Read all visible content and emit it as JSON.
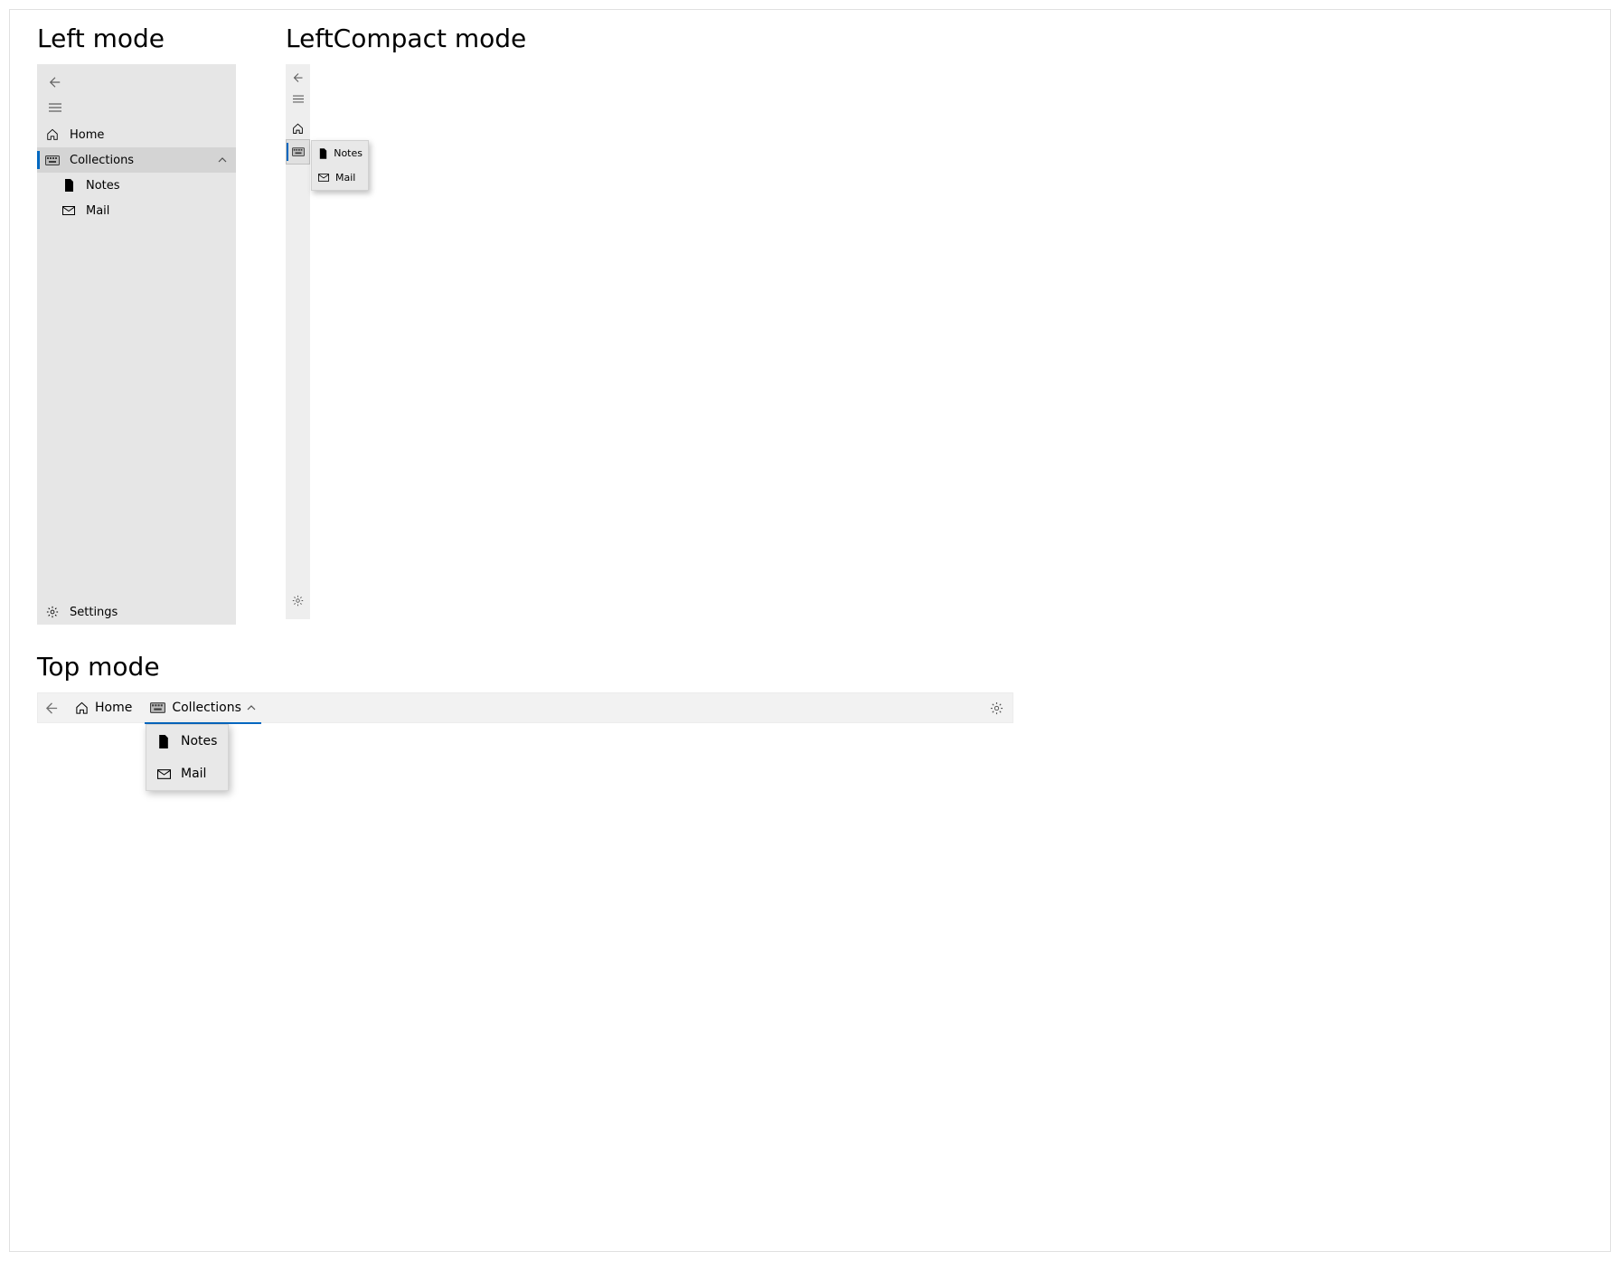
{
  "sections": {
    "left_title": "Left mode",
    "compact_title": "LeftCompact mode",
    "top_title": "Top mode"
  },
  "nav": {
    "home": "Home",
    "collections": "Collections",
    "notes": "Notes",
    "mail": "Mail",
    "settings": "Settings"
  },
  "colors": {
    "accent": "#0067c0",
    "pane_bg": "#e6e6e6",
    "compact_bg": "#eeeeee",
    "topbar_bg": "#f2f2f2"
  }
}
